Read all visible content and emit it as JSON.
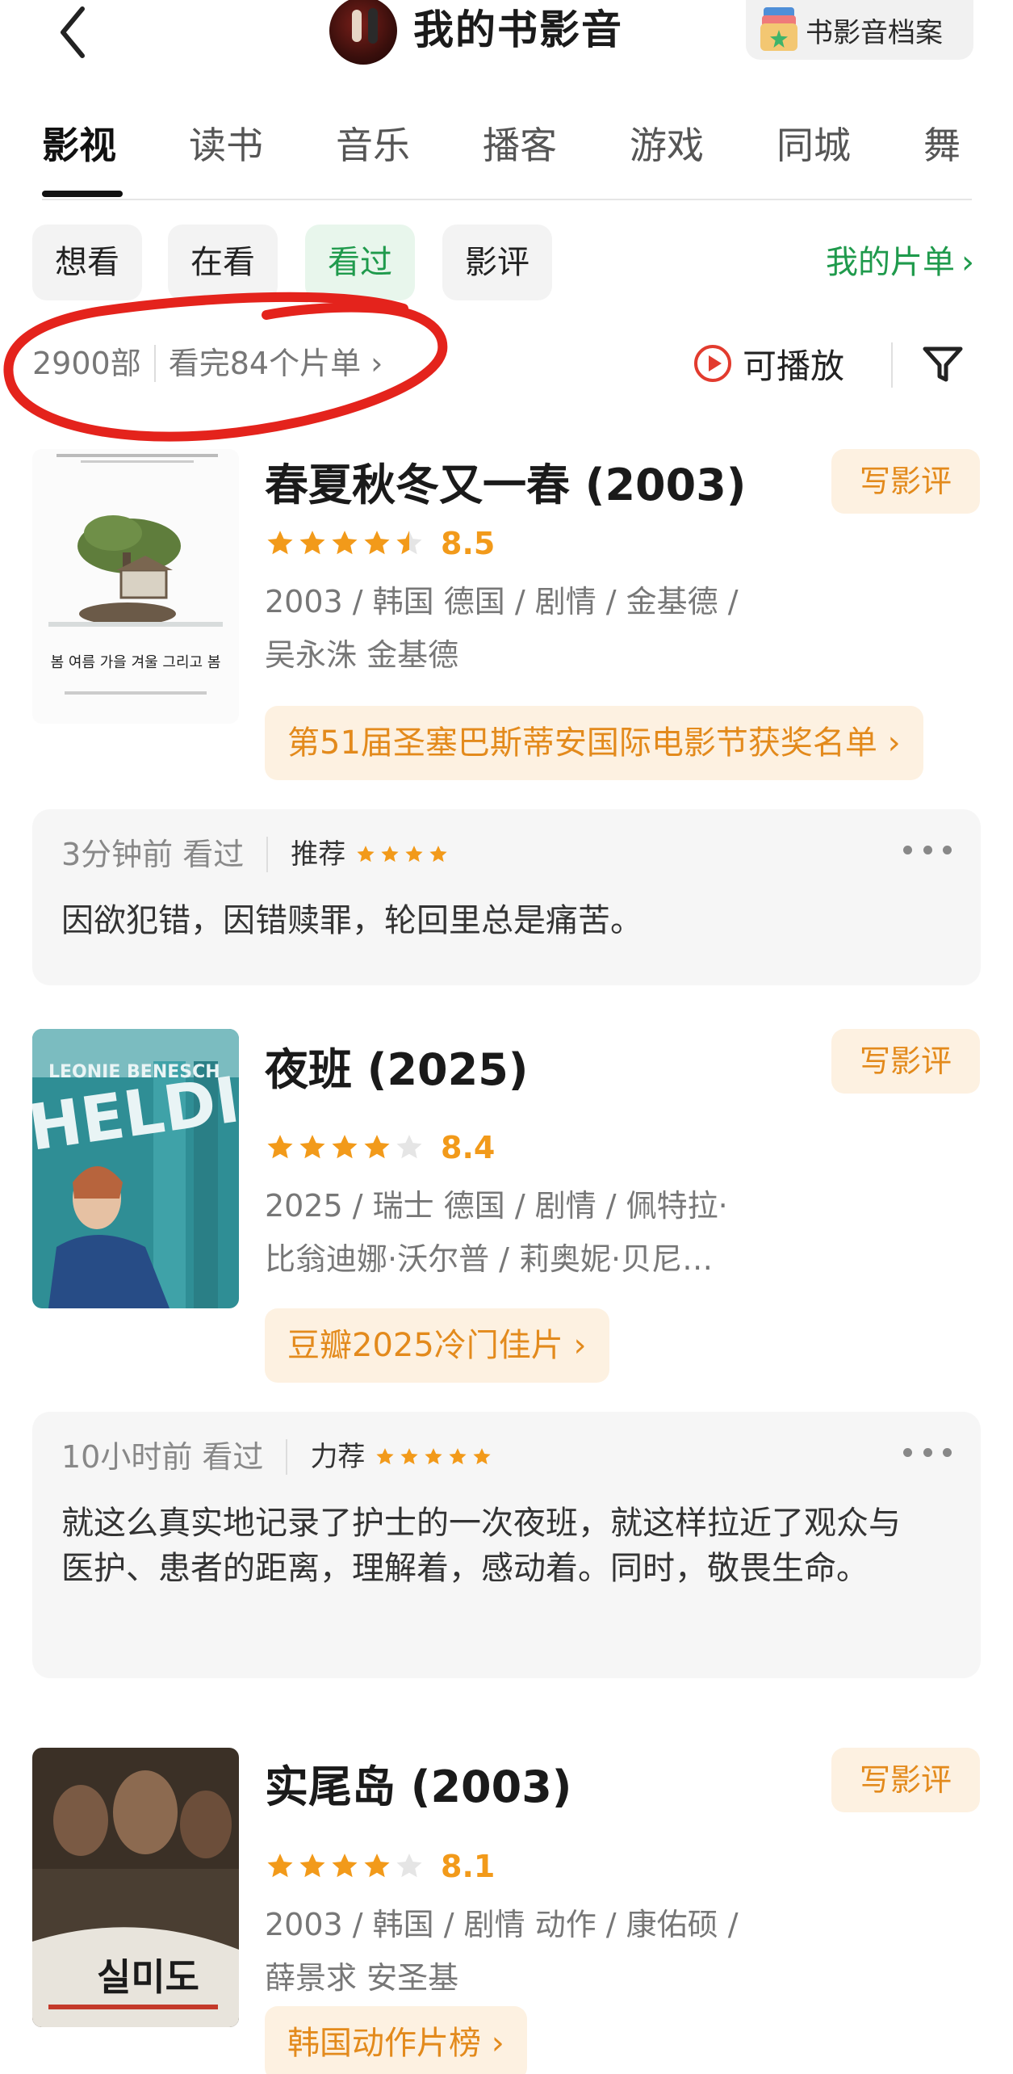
{
  "header": {
    "title": "我的书影音",
    "archive_label": "书影音档案"
  },
  "tabs": [
    "影视",
    "读书",
    "音乐",
    "播客",
    "游戏",
    "同城",
    "舞"
  ],
  "active_tab": "影视",
  "filters": [
    "想看",
    "在看",
    "看过",
    "影评"
  ],
  "active_filter": "看过",
  "my_list_label": "我的片单",
  "stats": {
    "count": "2900部",
    "finished_lists": "看完84个片单",
    "playable_label": "可播放"
  },
  "colors": {
    "accent_green": "#1f9a4c",
    "accent_orange": "#f29a1a",
    "annotation_red": "#e4231c"
  },
  "movies": [
    {
      "title": "春夏秋冬又一春 (2003)",
      "review_btn": "写影评",
      "stars": 4.5,
      "score": "8.5",
      "meta_line1": "2003 / 韩国 德国 / 剧情 / 金基德 /",
      "meta_line2": "吴永洙 金基德",
      "award": "第51届圣塞巴斯蒂安国际电影节获奖名单",
      "comment": {
        "time": "3分钟前 看过",
        "level": "推荐",
        "user_stars": 4,
        "text": "因欲犯错，因错赎罪，轮回里总是痛苦。"
      }
    },
    {
      "title": "夜班 (2025)",
      "review_btn": "写影评",
      "stars": 4,
      "score": "8.4",
      "meta_line1": "2025 / 瑞士 德国 / 剧情 / 佩特拉·",
      "meta_line2": "比翁迪娜·沃尔普 / 莉奥妮·贝尼…",
      "award": "豆瓣2025冷门佳片",
      "comment": {
        "time": "10小时前 看过",
        "level": "力荐",
        "user_stars": 5,
        "text": "就这么真实地记录了护士的一次夜班，就这样拉近了观众与医护、患者的距离，理解着，感动着。同时，敬畏生命。"
      }
    },
    {
      "title": "实尾岛 (2003)",
      "review_btn": "写影评",
      "stars": 4,
      "score": "8.1",
      "meta_line1": "2003 / 韩国 / 剧情 动作 / 康佑硕 /",
      "meta_line2": "薛景求 安圣基",
      "award": "韩国动作片榜"
    }
  ],
  "poster_texts": {
    "p1_title": "봄 여름 가을 겨울 그리고 봄",
    "p2_actor": "LEONIE BENESCH",
    "p2_title": "HELDIN",
    "p3_title": "실미도"
  }
}
